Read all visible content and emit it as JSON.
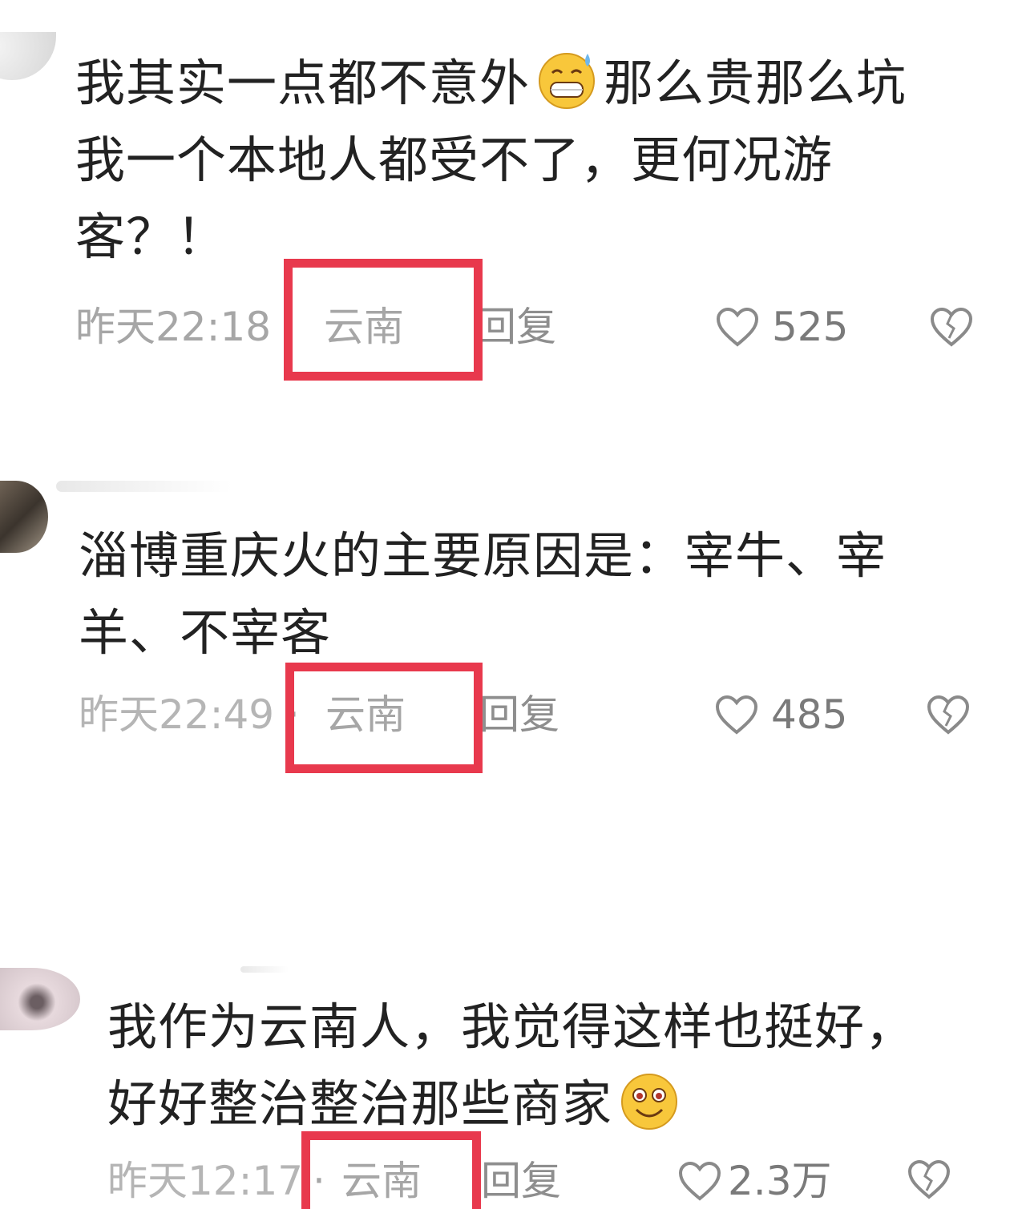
{
  "comments": [
    {
      "text_lines": [
        "我其实一点都不意外",
        "那么贵那么坑",
        "我一个本地人都受不了，更何况游",
        "客？！"
      ],
      "time": "昨天22:18",
      "separator": "·",
      "location": "云南",
      "reply": "回复",
      "likes": "525",
      "emoji": "sweat-grin-emoji"
    },
    {
      "text_lines": [
        "淄博重庆火的主要原因是：宰牛、宰",
        "羊、不宰客"
      ],
      "time": "昨天22:49",
      "separator": "·",
      "location": "云南",
      "reply": "回复",
      "likes": "485"
    },
    {
      "text_lines": [
        "我作为云南人，我觉得这样也挺好，",
        "好好整治整治那些商家"
      ],
      "time": "昨天12:17",
      "separator": "·",
      "location": "云南",
      "reply": "回复",
      "likes": "2.3万",
      "emoji": "smile-emoji"
    }
  ],
  "colors": {
    "highlight_box": "#e8394d",
    "text": "#222222",
    "meta": "#a6a6a6"
  }
}
